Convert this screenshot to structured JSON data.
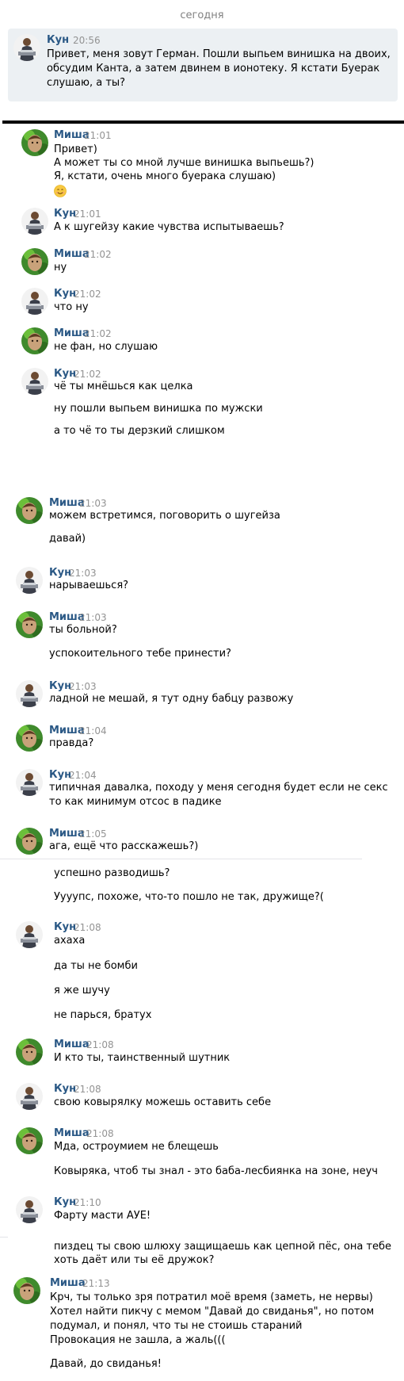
{
  "date_label": "сегодня",
  "colors": {
    "name": "#2a5885",
    "time": "#939393",
    "highlight_bg": "#ecf0f3",
    "date": "#828282"
  },
  "messages": [
    {
      "author": "Кун",
      "time": "20:56",
      "lines": [
        "Привет, меня зовут Герман. Пошли выпьем винишка на двоих,",
        "обсудим Канта, а затем двинем в ионотеку. Я кстати Буерак",
        "слушаю, а ты?"
      ]
    },
    {
      "author": "Миша",
      "time": "21:01",
      "lines": [
        "Привет)",
        "А может ты со мной лучше винишка выпьешь?)",
        "Я, кстати, очень много буерака слушаю)"
      ],
      "emoji": "smiling-face-icon"
    },
    {
      "author": "Кун",
      "time": "21:01",
      "lines": [
        "А к шугейзу какие чувства испытываешь?"
      ]
    },
    {
      "author": "Миша",
      "time": "21:02",
      "lines": [
        "ну"
      ]
    },
    {
      "author": "Кун",
      "time": "21:02",
      "lines": [
        "что ну"
      ]
    },
    {
      "author": "Миша",
      "time": "21:02",
      "lines": [
        "не фан, но слушаю"
      ]
    },
    {
      "author": "Кун",
      "time": "21:02",
      "lines": [
        "чё ты мнёшься как целка",
        "ну пошли выпьем винишка по мужски",
        "а то чё то ты дерзкий слишком"
      ]
    },
    {
      "author": "Миша",
      "time": "21:03",
      "lines": [
        "можем встретимся, поговорить о шугейза",
        "давай)"
      ]
    },
    {
      "author": "Кун",
      "time": "21:03",
      "lines": [
        "нарываешься?"
      ]
    },
    {
      "author": "Миша",
      "time": "21:03",
      "lines": [
        "ты больной?",
        "успокоительного тебе принести?"
      ]
    },
    {
      "author": "Кун",
      "time": "21:03",
      "lines": [
        "ладной не мешай, я тут одну бабцу развожу"
      ]
    },
    {
      "author": "Миша",
      "time": "21:04",
      "lines": [
        "правда?"
      ]
    },
    {
      "author": "Кун",
      "time": "21:04",
      "lines": [
        "типичная давалка, походу у меня сегодня будет если не секс",
        "то как минимум отсос в падике"
      ]
    },
    {
      "author": "Миша",
      "time": "21:05",
      "lines": [
        "ага, ещё что расскажешь?)",
        "успешно разводишь?",
        "Уууупс, похоже, что-то пошло не так, дружище?("
      ]
    },
    {
      "author": "Кун",
      "time": "21:08",
      "lines": [
        "ахаха",
        "да ты не бомби",
        "я же шучу",
        "не парься, братух"
      ]
    },
    {
      "author": "Миша",
      "time": "21:08",
      "lines": [
        "И кто ты, таинственный шутник"
      ]
    },
    {
      "author": "Кун",
      "time": "21:08",
      "lines": [
        "свою ковырялку можешь оставить себе"
      ]
    },
    {
      "author": "Миша",
      "time": "21:08",
      "lines": [
        "Мда, остроумием не блещешь",
        "Ковыряка, чтоб ты знал - это баба-лесбиянка на зоне, неуч"
      ]
    },
    {
      "author": "Кун",
      "time": "21:10",
      "lines": [
        "Фарту масти АУЕ!",
        "пиздец ты свою шлюху защищаешь как цепной пёс, она тебе",
        "хоть даёт или ты её дружок?"
      ]
    },
    {
      "author": "Миша",
      "time": "21:13",
      "lines": [
        "Крч, ты только зря потратил моё время (заметь, не нервы)",
        "Хотел найти пикчу с мемом \"Давай до свиданья\", но потом",
        "подумал, и понял, что ты не стоишь стараний",
        "Провокация не зашла, а жаль(((",
        "Давай, до свиданья!"
      ]
    }
  ]
}
